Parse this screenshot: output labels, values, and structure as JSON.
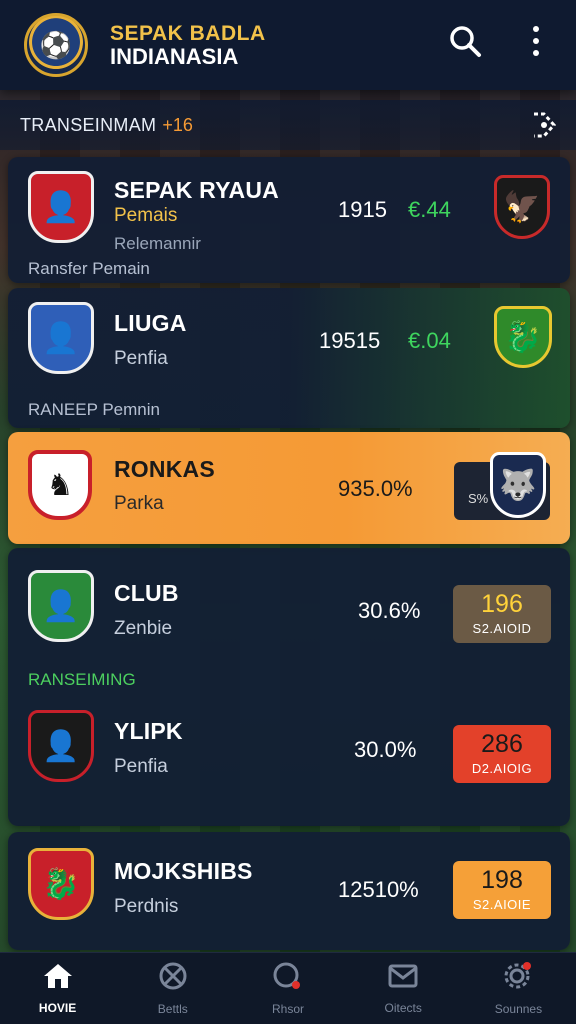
{
  "header": {
    "title_line1": "SEPAK BADLA",
    "title_line2": "INDIANASIA",
    "search_icon": "search-icon",
    "more_icon": "more-vertical-icon"
  },
  "section": {
    "title": "TRANSEINMAM",
    "badge": "+16",
    "share_icon": "share-icon"
  },
  "cards": [
    {
      "name": "SEPAK RYAUA",
      "subtitle": "Pemais",
      "line3": "Relemannir",
      "footer": "Ransfer Pemain",
      "value": "1915",
      "delta": "€.44"
    },
    {
      "name": "LIUGA",
      "subtitle": "Penfia",
      "footer": "RANEEP Pemnin",
      "value": "19515",
      "delta": "€.04"
    },
    {
      "name": "RONKAS",
      "subtitle": "Parka",
      "value": "935.0%",
      "pill": "S%"
    },
    {
      "name": "CLUB",
      "subtitle": "Zenbie",
      "footer": "RANSEIMING",
      "value": "30.6%",
      "pill_big": "196",
      "pill_small": "S2.AIOID"
    },
    {
      "name": "YLIPK",
      "subtitle": "Penfia",
      "value": "30.0%",
      "pill_big": "286",
      "pill_small": "D2.AIOIG"
    },
    {
      "name": "MOJKSHIBS",
      "subtitle": "Perdnis",
      "value": "12510%",
      "pill_big": "198",
      "pill_small": "S2.AIOIE"
    }
  ],
  "bottom_nav": [
    {
      "label": "HOVIE",
      "icon": "home-icon",
      "active": true
    },
    {
      "label": "Bettls",
      "icon": "ball-icon",
      "active": false
    },
    {
      "label": "Rhsor",
      "icon": "whistle-icon",
      "active": false
    },
    {
      "label": "Oitects",
      "icon": "inbox-icon",
      "active": false
    },
    {
      "label": "Sounnes",
      "icon": "settings-icon",
      "active": false
    }
  ],
  "colors": {
    "header_bg": "#0f1a30",
    "accent_orange": "#f59a35",
    "delta_green": "#3ed55e",
    "gold": "#f2c24a"
  }
}
